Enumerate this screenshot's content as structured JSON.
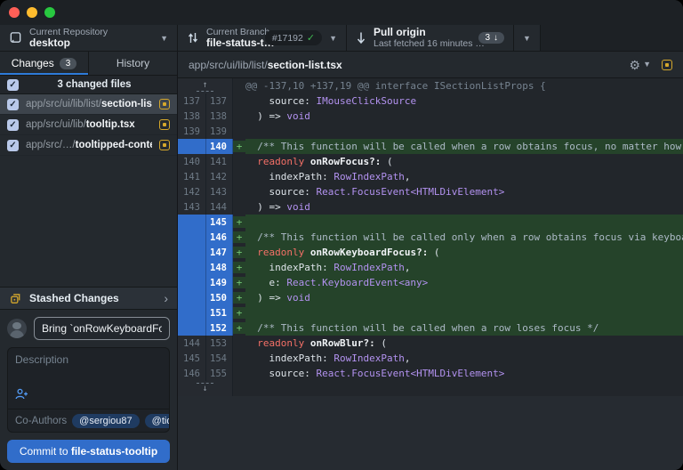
{
  "colors": {
    "accent_blue": "#316dca",
    "tab_underline": "#2e7bd9",
    "added_line_bg": "#25432a",
    "added_gutter_blue": "#316dca",
    "modified_yellow": "#d4a72c",
    "success_green": "#3fb950",
    "traffic_red": "#ff5f57",
    "traffic_yellow": "#febc2e",
    "traffic_green": "#28c840"
  },
  "toolbar": {
    "repository": {
      "label": "Current Repository",
      "value": "desktop"
    },
    "branch": {
      "label": "Current Branch",
      "value": "file-status-t…",
      "badge": "#17192"
    },
    "pull": {
      "title": "Pull origin",
      "subtitle": "Last fetched 16 minutes …",
      "badge_count": "3",
      "badge_arrow": "↓"
    }
  },
  "sidebar": {
    "tabs": [
      {
        "label": "Changes",
        "badge": "3",
        "active": true
      },
      {
        "label": "History",
        "badge": "",
        "active": false
      }
    ],
    "files_header": {
      "label": "3 changed files"
    },
    "files": [
      {
        "dir": "app/src/ui/lib/list/",
        "name": "section-list.tsx",
        "selected": true
      },
      {
        "dir": "app/src/ui/lib/",
        "name": "tooltip.tsx",
        "selected": false
      },
      {
        "dir": "app/src/…/",
        "name": "tooltipped-content.tsx",
        "selected": false
      }
    ],
    "stashed": {
      "label": "Stashed Changes"
    },
    "commit": {
      "summary_value": "Bring `onRowKeyboardFocus` to",
      "description_placeholder": "Description",
      "coauthors_label": "Co-Authors",
      "coauthors": [
        "@sergiou87",
        "@tidy-dev"
      ],
      "button_prefix": "Commit to ",
      "button_branch": "file-status-tooltip"
    }
  },
  "diff": {
    "path_dir": "app/src/ui/lib/list/",
    "path_file": "section-list.tsx",
    "rows": [
      {
        "kind": "hunk",
        "text": "@@ -137,10 +137,19 @@ interface ISectionListProps {"
      },
      {
        "kind": "ctx",
        "old": "137",
        "new": "137",
        "segs": [
          {
            "t": "    source: ",
            "s": "plain"
          },
          {
            "t": "IMouseClickSource",
            "s": "type"
          }
        ]
      },
      {
        "kind": "ctx",
        "old": "138",
        "new": "138",
        "segs": [
          {
            "t": "  ) => ",
            "s": "plain"
          },
          {
            "t": "void",
            "s": "type"
          }
        ]
      },
      {
        "kind": "ctx",
        "old": "139",
        "new": "139",
        "segs": []
      },
      {
        "kind": "add",
        "old": "",
        "new": "140",
        "marker": "+",
        "segs": [
          {
            "t": "  /** This function will be called when a row obtains focus, no matter how */",
            "s": "comment"
          }
        ]
      },
      {
        "kind": "ctx",
        "old": "140",
        "new": "141",
        "segs": [
          {
            "t": "  ",
            "s": "plain"
          },
          {
            "t": "readonly",
            "s": "keyword"
          },
          {
            "t": " ",
            "s": "plain"
          },
          {
            "t": "onRowFocus?:",
            "s": "prop"
          },
          {
            "t": " (",
            "s": "plain"
          }
        ]
      },
      {
        "kind": "ctx",
        "old": "141",
        "new": "142",
        "segs": [
          {
            "t": "    indexPath: ",
            "s": "plain"
          },
          {
            "t": "RowIndexPath",
            "s": "type"
          },
          {
            "t": ",",
            "s": "plain"
          }
        ]
      },
      {
        "kind": "ctx",
        "old": "142",
        "new": "143",
        "segs": [
          {
            "t": "    source: ",
            "s": "plain"
          },
          {
            "t": "React.FocusEvent<HTMLDivElement>",
            "s": "type"
          }
        ]
      },
      {
        "kind": "ctx",
        "old": "143",
        "new": "144",
        "segs": [
          {
            "t": "  ) => ",
            "s": "plain"
          },
          {
            "t": "void",
            "s": "type"
          }
        ]
      },
      {
        "kind": "add",
        "old": "",
        "new": "145",
        "marker": "+",
        "segs": []
      },
      {
        "kind": "add",
        "old": "",
        "new": "146",
        "marker": "+",
        "segs": [
          {
            "t": "  /** This function will be called only when a row obtains focus via keyboard */",
            "s": "comment"
          }
        ]
      },
      {
        "kind": "add",
        "old": "",
        "new": "147",
        "marker": "+",
        "segs": [
          {
            "t": "  ",
            "s": "plain"
          },
          {
            "t": "readonly",
            "s": "keyword"
          },
          {
            "t": " ",
            "s": "plain"
          },
          {
            "t": "onRowKeyboardFocus?:",
            "s": "prop"
          },
          {
            "t": " (",
            "s": "plain"
          }
        ]
      },
      {
        "kind": "add",
        "old": "",
        "new": "148",
        "marker": "+",
        "segs": [
          {
            "t": "    indexPath: ",
            "s": "plain"
          },
          {
            "t": "RowIndexPath",
            "s": "type"
          },
          {
            "t": ",",
            "s": "plain"
          }
        ]
      },
      {
        "kind": "add",
        "old": "",
        "new": "149",
        "marker": "+",
        "segs": [
          {
            "t": "    e: ",
            "s": "plain"
          },
          {
            "t": "React.KeyboardEvent<any>",
            "s": "type"
          }
        ]
      },
      {
        "kind": "add",
        "old": "",
        "new": "150",
        "marker": "+",
        "segs": [
          {
            "t": "  ) => ",
            "s": "plain"
          },
          {
            "t": "void",
            "s": "type"
          }
        ]
      },
      {
        "kind": "add",
        "old": "",
        "new": "151",
        "marker": "+",
        "segs": []
      },
      {
        "kind": "add",
        "old": "",
        "new": "152",
        "marker": "+",
        "segs": [
          {
            "t": "  /** This function will be called when a row loses focus */",
            "s": "comment"
          }
        ]
      },
      {
        "kind": "ctx",
        "old": "144",
        "new": "153",
        "segs": [
          {
            "t": "  ",
            "s": "plain"
          },
          {
            "t": "readonly",
            "s": "keyword"
          },
          {
            "t": " ",
            "s": "plain"
          },
          {
            "t": "onRowBlur?:",
            "s": "prop"
          },
          {
            "t": " (",
            "s": "plain"
          }
        ]
      },
      {
        "kind": "ctx",
        "old": "145",
        "new": "154",
        "segs": [
          {
            "t": "    indexPath: ",
            "s": "plain"
          },
          {
            "t": "RowIndexPath",
            "s": "type"
          },
          {
            "t": ",",
            "s": "plain"
          }
        ]
      },
      {
        "kind": "ctx",
        "old": "146",
        "new": "155",
        "segs": [
          {
            "t": "    source: ",
            "s": "plain"
          },
          {
            "t": "React.FocusEvent<HTMLDivElement>",
            "s": "type"
          }
        ]
      },
      {
        "kind": "expand"
      }
    ]
  }
}
